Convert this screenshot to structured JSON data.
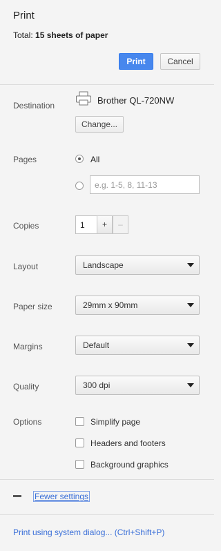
{
  "header": {
    "title": "Print",
    "total_label": "Total:",
    "total_value": "15 sheets of paper",
    "print_label": "Print",
    "cancel_label": "Cancel"
  },
  "destination": {
    "label": "Destination",
    "printer_name": "Brother QL-720NW",
    "change_label": "Change...",
    "icon": "printer-icon"
  },
  "pages": {
    "label": "Pages",
    "all_label": "All",
    "custom_placeholder": "e.g. 1-5, 8, 11-13",
    "selected": "All"
  },
  "copies": {
    "label": "Copies",
    "value": "1",
    "plus_label": "+",
    "minus_label": "–"
  },
  "layout": {
    "label": "Layout",
    "value": "Landscape"
  },
  "paper_size": {
    "label": "Paper size",
    "value": "29mm x 90mm"
  },
  "margins": {
    "label": "Margins",
    "value": "Default"
  },
  "quality": {
    "label": "Quality",
    "value": "300 dpi"
  },
  "options": {
    "label": "Options",
    "items": [
      {
        "label": "Simplify page",
        "checked": false
      },
      {
        "label": "Headers and footers",
        "checked": false
      },
      {
        "label": "Background graphics",
        "checked": false
      }
    ]
  },
  "footer": {
    "fewer_settings_label": "Fewer settings",
    "system_dialog_label": "Print using system dialog... (Ctrl+Shift+P)"
  },
  "colors": {
    "accent": "#4787ed",
    "link": "#3a6fd8",
    "background": "#f4f4f4"
  }
}
